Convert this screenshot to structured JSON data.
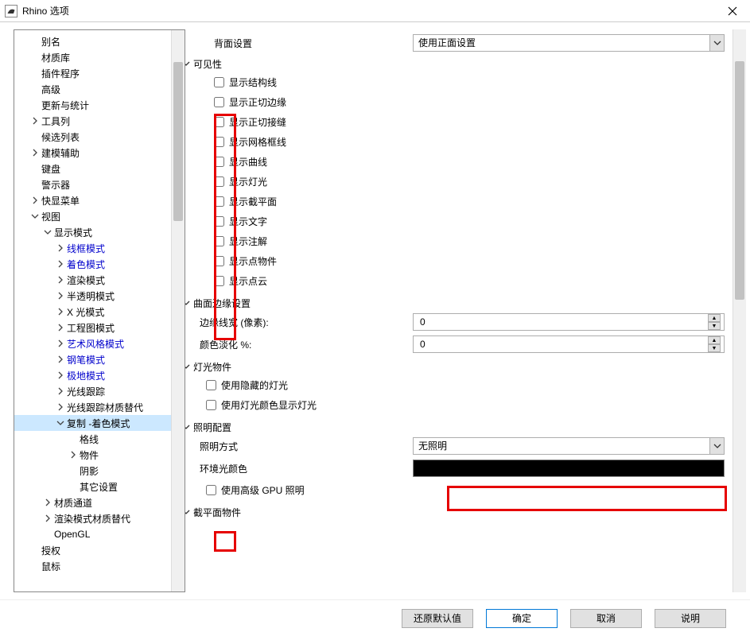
{
  "window": {
    "title": "Rhino 选项"
  },
  "tree": [
    {
      "lbl": "别名",
      "ind": 1,
      "tw": "none"
    },
    {
      "lbl": "材质库",
      "ind": 1,
      "tw": "none"
    },
    {
      "lbl": "插件程序",
      "ind": 1,
      "tw": "none"
    },
    {
      "lbl": "高级",
      "ind": 1,
      "tw": "none"
    },
    {
      "lbl": "更新与统计",
      "ind": 1,
      "tw": "none"
    },
    {
      "lbl": "工具列",
      "ind": 1,
      "tw": "closed"
    },
    {
      "lbl": "候选列表",
      "ind": 1,
      "tw": "none"
    },
    {
      "lbl": "建模辅助",
      "ind": 1,
      "tw": "closed"
    },
    {
      "lbl": "键盘",
      "ind": 1,
      "tw": "none"
    },
    {
      "lbl": "警示器",
      "ind": 1,
      "tw": "none"
    },
    {
      "lbl": "快显菜单",
      "ind": 1,
      "tw": "closed"
    },
    {
      "lbl": "视图",
      "ind": 1,
      "tw": "open"
    },
    {
      "lbl": "显示模式",
      "ind": 2,
      "tw": "open"
    },
    {
      "lbl": "线框模式",
      "ind": 3,
      "tw": "closed",
      "blue": true
    },
    {
      "lbl": "着色模式",
      "ind": 3,
      "tw": "closed",
      "blue": true
    },
    {
      "lbl": "渲染模式",
      "ind": 3,
      "tw": "closed"
    },
    {
      "lbl": "半透明模式",
      "ind": 3,
      "tw": "closed"
    },
    {
      "lbl": "X 光模式",
      "ind": 3,
      "tw": "closed"
    },
    {
      "lbl": "工程图模式",
      "ind": 3,
      "tw": "closed"
    },
    {
      "lbl": "艺术风格模式",
      "ind": 3,
      "tw": "closed",
      "blue": true
    },
    {
      "lbl": "钢笔模式",
      "ind": 3,
      "tw": "closed",
      "blue": true
    },
    {
      "lbl": "极地模式",
      "ind": 3,
      "tw": "closed",
      "blue": true
    },
    {
      "lbl": "光线跟踪",
      "ind": 3,
      "tw": "closed"
    },
    {
      "lbl": "光线跟踪材质替代",
      "ind": 3,
      "tw": "closed"
    },
    {
      "lbl": "复制 -着色模式",
      "ind": 3,
      "tw": "open",
      "sel": true
    },
    {
      "lbl": "格线",
      "ind": 4,
      "tw": "none"
    },
    {
      "lbl": "物件",
      "ind": 4,
      "tw": "closed"
    },
    {
      "lbl": "阴影",
      "ind": 4,
      "tw": "none"
    },
    {
      "lbl": "其它设置",
      "ind": 4,
      "tw": "none"
    },
    {
      "lbl": "材质通道",
      "ind": 2,
      "tw": "closed"
    },
    {
      "lbl": "渲染模式材质替代",
      "ind": 2,
      "tw": "closed"
    },
    {
      "lbl": "OpenGL",
      "ind": 2,
      "tw": "none"
    },
    {
      "lbl": "授权",
      "ind": 1,
      "tw": "none"
    },
    {
      "lbl": "鼠标",
      "ind": 1,
      "tw": "none"
    }
  ],
  "right": {
    "backface": {
      "label": "背面设置",
      "value": "使用正面设置"
    },
    "visibility": {
      "title": "可见性",
      "items": [
        "显示结构线",
        "显示正切边缘",
        "显示正切接缝",
        "显示网格框线",
        "显示曲线",
        "显示灯光",
        "显示截平面",
        "显示文字",
        "显示注解",
        "显示点物件",
        "显示点云"
      ]
    },
    "surface_edge": {
      "title": "曲面边缘设置",
      "edge_width_label": "边缘线宽 (像素):",
      "edge_width_value": "0",
      "fade_label": "颜色淡化 %:",
      "fade_value": "0"
    },
    "light_obj": {
      "title": "灯光物件",
      "hidden": "使用隐藏的灯光",
      "color": "使用灯光颜色显示灯光"
    },
    "lighting": {
      "title": "照明配置",
      "method_label": "照明方式",
      "method_value": "无照明",
      "ambient_label": "环境光颜色",
      "gpu": "使用高级 GPU 照明"
    },
    "clip": {
      "title": "截平面物件"
    }
  },
  "buttons": {
    "restore": "还原默认值",
    "ok": "确定",
    "cancel": "取消",
    "help": "说明"
  }
}
